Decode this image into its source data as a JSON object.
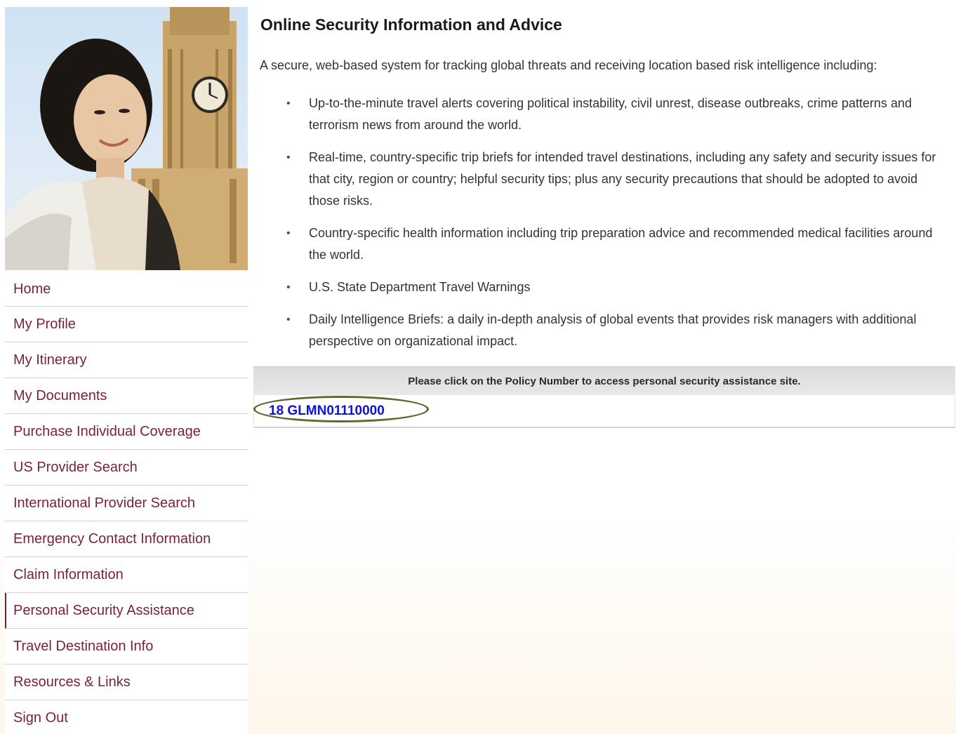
{
  "sidebar": {
    "nav": [
      {
        "label": "Home"
      },
      {
        "label": "My Profile"
      },
      {
        "label": "My Itinerary"
      },
      {
        "label": "My Documents"
      },
      {
        "label": "Purchase Individual Coverage"
      },
      {
        "label": "US Provider Search"
      },
      {
        "label": "International Provider Search"
      },
      {
        "label": "Emergency Contact Information"
      },
      {
        "label": "Claim Information"
      },
      {
        "label": "Personal Security Assistance"
      },
      {
        "label": "Travel Destination Info"
      },
      {
        "label": "Resources & Links"
      },
      {
        "label": "Sign Out"
      }
    ],
    "active_item": "Personal Security Assistance"
  },
  "main": {
    "title": "Online Security Information and Advice",
    "intro": "A secure, web-based system for tracking global threats and receiving location based risk intelligence including:",
    "bullets": [
      "Up-to-the-minute travel alerts covering political instability, civil unrest, disease outbreaks, crime patterns and terrorism news from around the world.",
      "Real-time, country-specific trip briefs for intended travel destinations, including any safety and security issues for that city, region or country; helpful security tips; plus any security precautions that should be adopted to avoid those risks.",
      "Country-specific health information including trip preparation advice and recommended medical facilities around the world.",
      "U.S. State Department Travel Warnings",
      "Daily Intelligence Briefs: a daily in-depth analysis of global events that provides risk managers with additional perspective on organizational impact."
    ],
    "bullet_glyph": "•",
    "notice": "Please click on the Policy Number to access personal security assistance site.",
    "policy_number": "18 GLMN01110000"
  },
  "colors": {
    "nav_text": "#7a1f3d",
    "policy_link": "#1010d8",
    "highlight_oval": "#5a6b2b"
  }
}
